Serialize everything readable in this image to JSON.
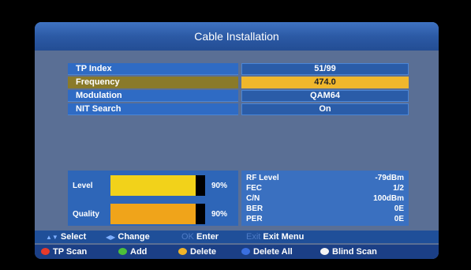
{
  "window": {
    "title": "Cable Installation"
  },
  "params": [
    {
      "label": "TP Index",
      "value": "51/99",
      "selected": false
    },
    {
      "label": "Frequency",
      "value": "474.0",
      "selected": true
    },
    {
      "label": "Modulation",
      "value": "QAM64",
      "selected": false
    },
    {
      "label": "NIT Search",
      "value": "On",
      "selected": false
    }
  ],
  "meters": {
    "level": {
      "label": "Level",
      "percent_text": "90%",
      "fraction": 0.9
    },
    "quality": {
      "label": "Quality",
      "percent_text": "90%",
      "fraction": 0.9
    }
  },
  "stats": [
    {
      "name": "RF Level",
      "value": "-79dBm"
    },
    {
      "name": "FEC",
      "value": "1/2"
    },
    {
      "name": "C/N",
      "value": "100dBm"
    },
    {
      "name": "BER",
      "value": "0E"
    },
    {
      "name": "PER",
      "value": "0E"
    }
  ],
  "help": {
    "select": "Select",
    "change": "Change",
    "ok_key": "OK",
    "enter": "Enter",
    "exit_key": "Exit",
    "exit_menu": "Exit Menu"
  },
  "color_buttons": {
    "red": "TP Scan",
    "green": "Add",
    "yellow": "Delete",
    "blue": "Delete All",
    "white": "Blind Scan"
  },
  "colors": {
    "level_bar": "#f2d21a",
    "quality_bar": "#f0a41a",
    "red": "#e63a2a",
    "green": "#4cbf3a",
    "yellow": "#f0b42a",
    "blue": "#3a6fe0",
    "white": "#f4f4f4"
  }
}
